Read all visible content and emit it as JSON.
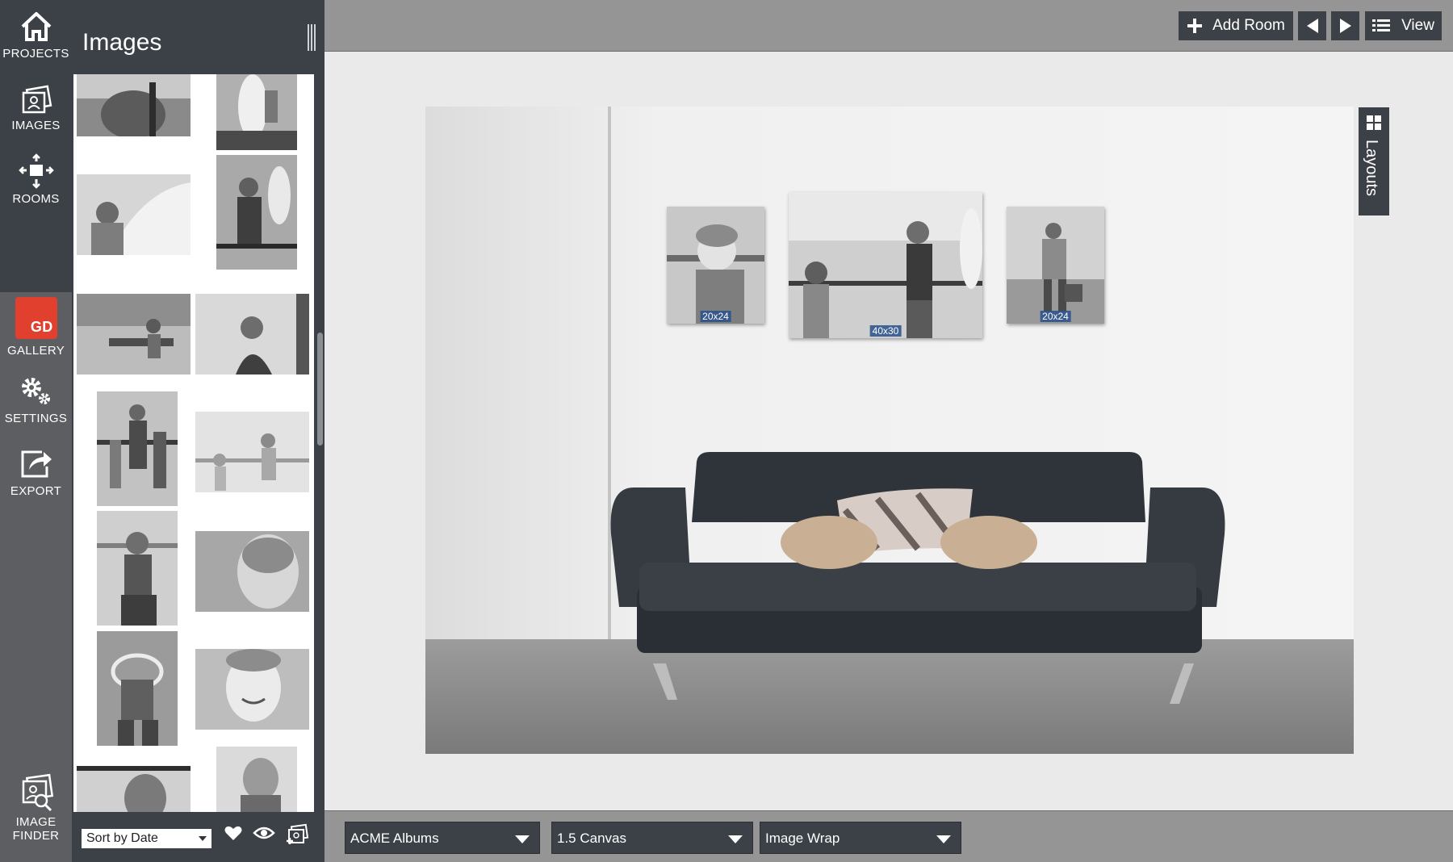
{
  "nav": {
    "projects": "PROJECTS",
    "images": "IMAGES",
    "rooms": "ROOMS",
    "gallery": "GALLERY",
    "gallery_logo": "GD",
    "settings": "SETTINGS",
    "export": "EXPORT",
    "image_finder_1": "IMAGE",
    "image_finder_2": "FINDER"
  },
  "panel": {
    "title": "Images",
    "sort_value": "Sort by Date"
  },
  "toolbar": {
    "add_room": "Add Room",
    "view": "View"
  },
  "room": {
    "layouts_label": "Layouts",
    "frames": [
      {
        "size": "20x24"
      },
      {
        "size": "40x30"
      },
      {
        "size": "20x24"
      }
    ]
  },
  "bottombar": {
    "album": "ACME Albums",
    "canvas": "1.5 Canvas",
    "wrap": "Image Wrap"
  },
  "colors": {
    "panel_dark": "#3c4147",
    "rail": "#5d5e61",
    "bar": "#959595",
    "gallery_red": "#e2402e"
  }
}
